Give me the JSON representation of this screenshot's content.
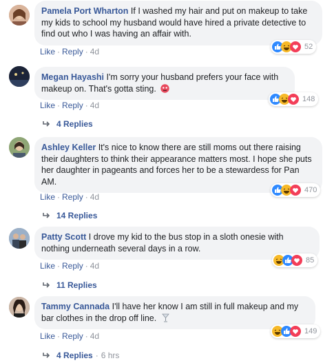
{
  "comments": [
    {
      "author": "Pamela Port Wharton",
      "text": "If I washed my hair and put on makeup to take my kids to school my husband would have hired a private detective to find out who I was having an affair with.",
      "actions": {
        "like": "Like",
        "reply": "Reply",
        "time": "4d"
      },
      "reactions": {
        "count": "52",
        "icons": [
          "like-icon",
          "haha-icon",
          "love-icon"
        ]
      },
      "avatar_color": "#c98a6a"
    },
    {
      "author": "Megan Hayashi",
      "text": "I'm sorry your husband prefers your face with makeup on. That's gotta sting.",
      "actions": {
        "like": "Like",
        "reply": "Reply",
        "time": "4d"
      },
      "reactions": {
        "count": "148",
        "icons": [
          "like-icon",
          "haha-icon",
          "love-icon"
        ]
      },
      "replies": {
        "label": "4 Replies"
      },
      "avatar_color": "#1f2a44"
    },
    {
      "author": "Ashley Keller",
      "text": "It's nice to know there are still moms out there raising their daughters to think their appearance matters most. I hope she puts her daughter in pageants and forces her to be a stewardess for Pan AM.",
      "actions": {
        "like": "Like",
        "reply": "Reply",
        "time": "4d"
      },
      "reactions": {
        "count": "470",
        "icons": [
          "like-icon",
          "haha-icon",
          "love-icon"
        ]
      },
      "replies": {
        "label": "14 Replies"
      },
      "avatar_color": "#8aa070"
    },
    {
      "author": "Patty Scott",
      "text": "I drove my kid to the bus stop in a sloth onesie with nothing underneath several days in a row.",
      "actions": {
        "like": "Like",
        "reply": "Reply",
        "time": "4d"
      },
      "reactions": {
        "count": "85",
        "icons": [
          "haha-icon",
          "like-icon",
          "love-icon"
        ]
      },
      "replies": {
        "label": "11 Replies"
      },
      "avatar_color": "#6f7f93"
    },
    {
      "author": "Tammy Cannada",
      "text": "I'll have her know I am still in full makeup and my bar clothes in the drop off line.",
      "actions": {
        "like": "Like",
        "reply": "Reply",
        "time": "4d"
      },
      "reactions": {
        "count": "149",
        "icons": [
          "haha-icon",
          "like-icon",
          "love-icon"
        ]
      },
      "replies": {
        "label": "4 Replies",
        "time": "6 hrs"
      },
      "avatar_color": "#7b5c4d"
    }
  ],
  "colors": {
    "name_link": "#385898",
    "bubble_bg": "#f2f3f5",
    "like_blue": "#2e89ff",
    "haha_yellow": "#f7b928",
    "love_red": "#f33e58",
    "muted": "#90949c"
  }
}
